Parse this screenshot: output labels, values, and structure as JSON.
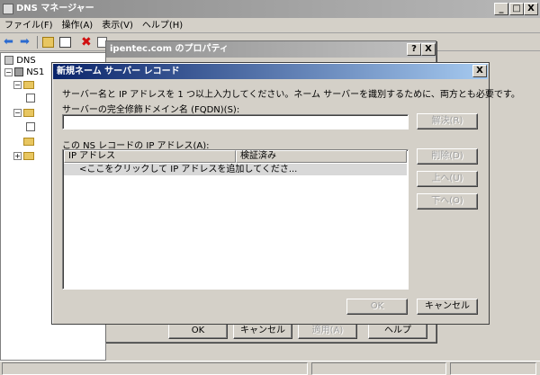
{
  "main_window": {
    "title": "DNS マネージャー",
    "caption_buttons": {
      "minimize": "_",
      "maximize": "□",
      "close": "X"
    },
    "menu": [
      "ファイル(F)",
      "操作(A)",
      "表示(V)",
      "ヘルプ(H)"
    ]
  },
  "toolbar": {
    "icons": [
      "back-icon",
      "forward-icon",
      "up-icon",
      "console-tree-icon",
      "delete-icon",
      "properties-icon",
      "refresh-icon",
      "export-icon",
      "help-icon",
      "show-icon",
      "filter-icon",
      "zone-icon"
    ]
  },
  "tree": {
    "root": "DNS",
    "server": "NS1"
  },
  "properties_dialog": {
    "title": "ipentec.com のプロパティ",
    "help_btn": "?",
    "close_btn": "X",
    "ok": "OK",
    "cancel": "キャンセル",
    "apply": "適用(A)",
    "help": "ヘルプ"
  },
  "ns_dialog": {
    "title": "新規ネーム サーバー レコード",
    "close_btn": "X",
    "instruction": "サーバー名と IP アドレスを 1 つ以上入力してください。ネーム サーバーを識別するために、両方とも必要です。",
    "fqdn_label": "サーバーの完全修飾ドメイン名 (FQDN)(S):",
    "fqdn_value": "",
    "resolve_btn": "解決(R)",
    "ip_list_label": "この NS レコードの IP アドレス(A):",
    "columns": [
      "IP アドレス",
      "検証済み"
    ],
    "add_row_placeholder": "<ここをクリックして IP アドレスを追加してくださ...",
    "delete_btn": "削除(D)",
    "up_btn": "上へ(U)",
    "down_btn": "下へ(O)",
    "ok": "OK",
    "cancel": "キャンセル"
  }
}
